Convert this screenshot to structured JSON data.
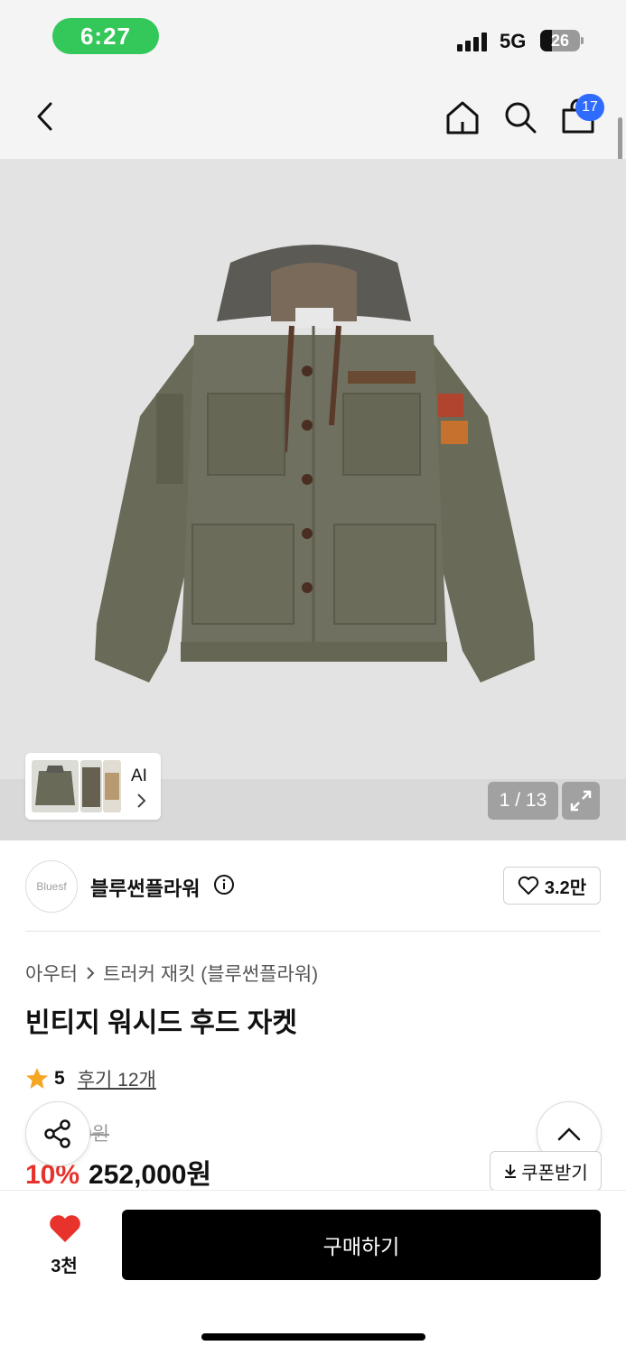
{
  "status_bar": {
    "time": "6:27",
    "network": "5G",
    "battery": "26"
  },
  "header": {
    "cart_count": "17"
  },
  "gallery": {
    "ai_label": "AI",
    "counter": "1 / 13"
  },
  "brand": {
    "logo_text": "Bluesf",
    "name": "블루썬플라워",
    "likes": "3.2만"
  },
  "product": {
    "breadcrumb": [
      "아우터",
      "트러커 재킷 (블루썬플라워)"
    ],
    "title": "빈티지 워시드 후드 자켓",
    "rating": "5",
    "reviews": "후기 12개",
    "original_price_fragment": "0원",
    "discount": "10%",
    "price": "252,000원",
    "coupon_label": "쿠폰받기"
  },
  "bottom_bar": {
    "heart_count": "3천",
    "buy_label": "구매하기"
  },
  "colors": {
    "status_pill": "#34c759",
    "badge": "#2f6bff",
    "discount": "#e8322c",
    "heart": "#e8322c",
    "star": "#f5a623"
  }
}
